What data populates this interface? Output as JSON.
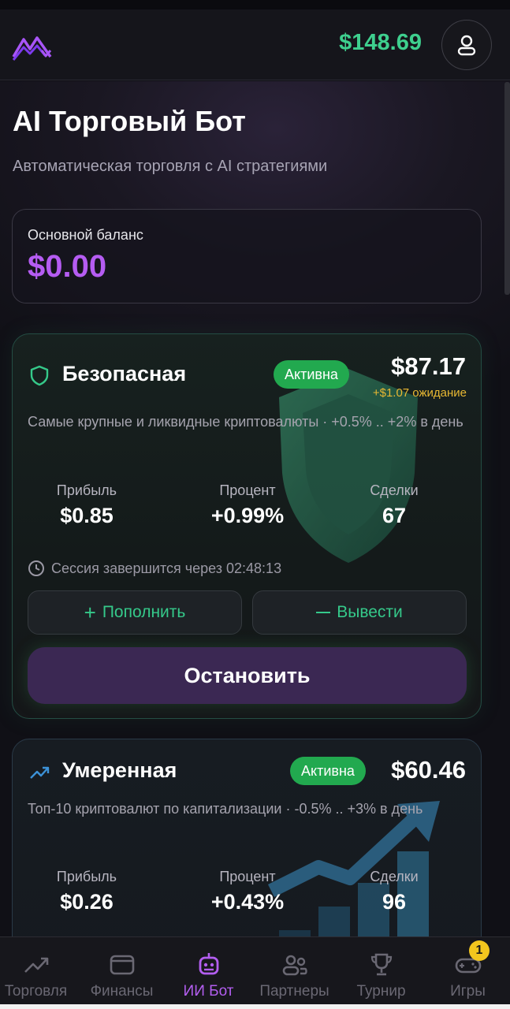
{
  "header": {
    "balance": "$148.69",
    "logo_icon": "mountain-chart-logo",
    "profile_icon": "user-icon"
  },
  "page": {
    "title": "AI Торговый Бот",
    "subtitle": "Автоматическая торговля с AI стратегиями"
  },
  "main_balance": {
    "label": "Основной баланс",
    "value": "$0.00"
  },
  "strategies": [
    {
      "name": "Безопасная",
      "icon": "shield-icon",
      "status": "Активна",
      "amount": "$87.17",
      "pending": "+$1.07 ожидание",
      "description": "Самые крупные и ликвидные криптовалюты · +0.5% .. +2% в день",
      "stats": [
        {
          "label": "Прибыль",
          "value": "$0.85"
        },
        {
          "label": "Процент",
          "value": "+0.99%"
        },
        {
          "label": "Сделки",
          "value": "67"
        }
      ],
      "session": "Сессия завершится через 02:48:13",
      "deposit_label": "Пополнить",
      "withdraw_label": "Вывести",
      "stop_label": "Остановить"
    },
    {
      "name": "Умеренная",
      "icon": "trend-up-icon",
      "status": "Активна",
      "amount": "$60.46",
      "description": "Топ-10 криптовалют по капитализации · -0.5% .. +3% в день",
      "stats": [
        {
          "label": "Прибыль",
          "value": "$0.26"
        },
        {
          "label": "Процент",
          "value": "+0.43%"
        },
        {
          "label": "Сделки",
          "value": "96"
        }
      ]
    }
  ],
  "nav": {
    "items": [
      {
        "label": "Торговля",
        "icon": "trend-up-icon"
      },
      {
        "label": "Финансы",
        "icon": "wallet-icon"
      },
      {
        "label": "ИИ Бот",
        "icon": "robot-icon"
      },
      {
        "label": "Партнеры",
        "icon": "users-icon"
      },
      {
        "label": "Турнир",
        "icon": "trophy-icon"
      },
      {
        "label": "Игры",
        "icon": "gamepad-icon"
      }
    ],
    "active": "ИИ Бот",
    "games_badge": "1"
  },
  "colors": {
    "accent_green": "#3ecf8e",
    "accent_purple": "#b55cf2",
    "status_green": "#22a94f",
    "pending_yellow": "#e8b833"
  }
}
